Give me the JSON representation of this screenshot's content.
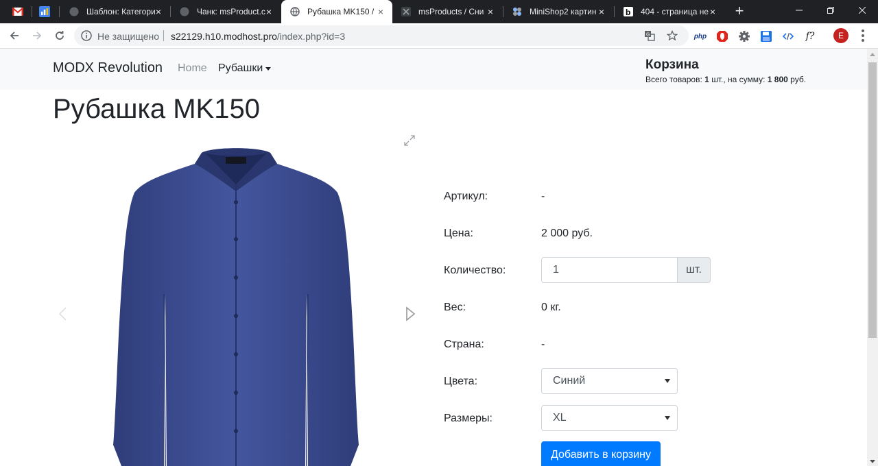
{
  "browser": {
    "tabs": [
      {
        "title": "Шаблон: Категори",
        "active": false
      },
      {
        "title": "Чанк: msProduct.c",
        "active": false
      },
      {
        "title": "Рубашка MK150 /",
        "active": true
      },
      {
        "title": "msProducts / Сни",
        "active": false
      },
      {
        "title": "MiniShop2 картин",
        "active": false
      },
      {
        "title": "404 - страница не",
        "active": false
      }
    ],
    "new_tab_label": "+",
    "omnibox": {
      "security_label": "Не защищено",
      "url_host": "s22129.h10.modhost.pro",
      "url_path": "/index.php?id=3"
    },
    "extensions": {
      "php_label": "php",
      "function_label": "f?"
    },
    "profile_initial": "E"
  },
  "navbar": {
    "brand": "MODX Revolution",
    "home": "Home",
    "shirts": "Рубашки"
  },
  "cart": {
    "title": "Корзина",
    "items_label": "Всего товаров:",
    "items_count": "1",
    "items_unit": "шт., на сумму:",
    "total": "1 800",
    "currency": "руб."
  },
  "product": {
    "title": "Рубашка MK150",
    "props": {
      "article_label": "Артикул:",
      "article_value": "-",
      "price_label": "Цена:",
      "price_value": "2 000 руб.",
      "qty_label": "Количество:",
      "qty_value": "1",
      "qty_unit": "шт.",
      "weight_label": "Вес:",
      "weight_value": "0 кг.",
      "country_label": "Страна:",
      "country_value": "-",
      "colors_label": "Цвета:",
      "colors_value": "Синий",
      "sizes_label": "Размеры:",
      "sizes_value": "XL"
    },
    "add_to_cart": "Добавить в корзину"
  },
  "colors": {
    "accent": "#007bff",
    "shirt": "#3b4a8c"
  },
  "icons": {
    "gmail": "gmail-icon",
    "analytics": "analytics-icon",
    "globe": "globe-icon",
    "expand": "expand-icon",
    "prev": "arrow-left-icon",
    "next": "arrow-right-icon"
  }
}
